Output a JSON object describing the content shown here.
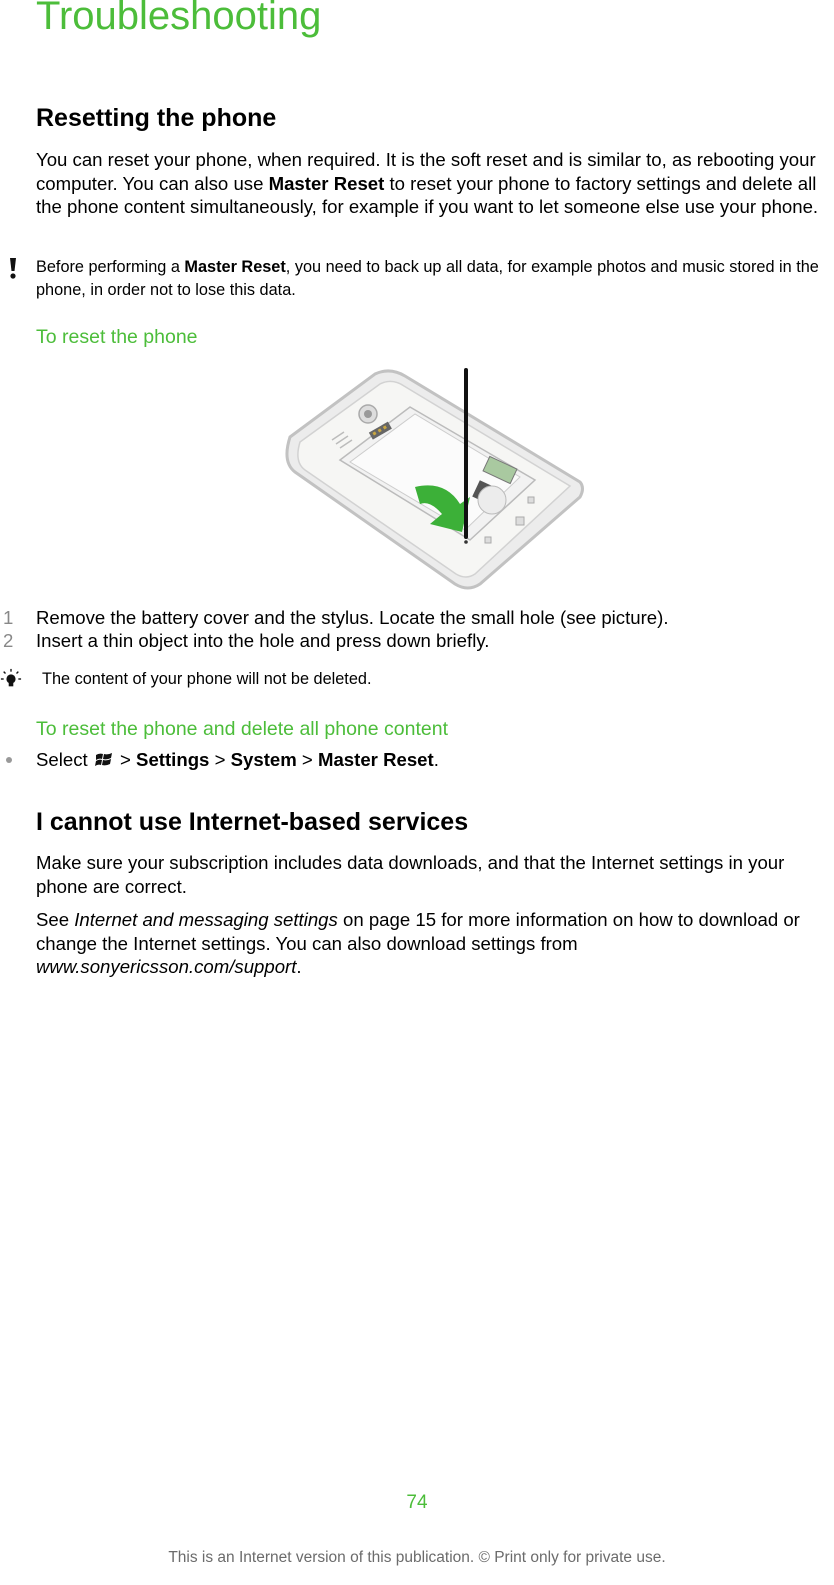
{
  "page": {
    "title": "Troubleshooting",
    "page_number": "74",
    "footer": "This is an Internet version of this publication. © Print only for private use."
  },
  "colors": {
    "accent_green": "#4cbd3a",
    "footer_gray": "#6b6b6b"
  },
  "section_reset": {
    "heading": "Resetting the phone",
    "intro": {
      "part1": "You can reset your phone, when required. It is the soft reset and is similar to, as rebooting your computer. You can also use ",
      "bold": "Master Reset",
      "part2": " to reset your phone to factory settings and delete all the phone content simultaneously, for example if you want to let someone else use your phone."
    },
    "warning": {
      "icon": "exclamation-icon",
      "part1": "Before performing a ",
      "bold": "Master Reset",
      "part2": ", you need to back up all data, for example photos and music stored in the phone, in order not to lose this data."
    },
    "procedure1": {
      "heading": "To reset the phone",
      "illustration": "phone-back-with-stylus-reset-hole",
      "steps": [
        {
          "num": "1",
          "text": "Remove the battery cover and the stylus. Locate the small hole (see picture)."
        },
        {
          "num": "2",
          "text": "Insert a thin object into the hole and press down briefly."
        }
      ],
      "tip": {
        "icon": "lightbulb-icon",
        "text": "The content of your phone will not be deleted."
      }
    },
    "procedure2": {
      "heading": "To reset the phone and delete all phone content",
      "step": {
        "prefix": "Select ",
        "icon": "windows-start-icon",
        "sep": " > ",
        "path": [
          "Settings",
          "System",
          "Master Reset"
        ],
        "suffix": "."
      }
    }
  },
  "section_internet": {
    "heading": "I cannot use Internet-based services",
    "para1": "Make sure your subscription includes data downloads, and that the Internet settings in your phone are correct.",
    "para2": {
      "prefix": "See ",
      "link": "Internet and messaging settings",
      "middle": " on page 15 for more information on how to download or change the Internet settings. You can also download settings from ",
      "url": "www.sonyericsson.com/support",
      "suffix": "."
    }
  }
}
